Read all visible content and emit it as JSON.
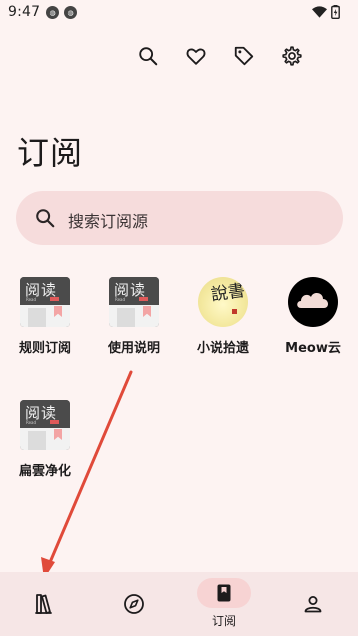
{
  "status_bar": {
    "time": "9:47",
    "notification_icons": [
      "app-notification-icon",
      "app-notification-icon"
    ],
    "right_icons": [
      "wifi-icon",
      "battery-icon"
    ]
  },
  "toolbar": {
    "icons": [
      "search-icon",
      "heart-icon",
      "tag-icon",
      "gear-icon"
    ]
  },
  "page": {
    "title": "订阅"
  },
  "search": {
    "placeholder": "搜索订阅源"
  },
  "sources": [
    {
      "name": "规则订阅",
      "icon": "reader-app-icon",
      "thumb_text": "阅读",
      "thumb_sub": "Read",
      "thumb_badge": "3.0"
    },
    {
      "name": "使用说明",
      "icon": "reader-app-icon",
      "thumb_text": "阅读",
      "thumb_sub": "Read",
      "thumb_badge": "3.0"
    },
    {
      "name": "小说拾遗",
      "icon": "calligraphy-icon",
      "thumb_text": "說書"
    },
    {
      "name": "Meow云",
      "icon": "cloud-icon"
    },
    {
      "name": "扁雲净化",
      "icon": "reader-app-icon",
      "thumb_text": "阅读",
      "thumb_sub": "Read",
      "thumb_badge": "3.0"
    }
  ],
  "bottom_nav": {
    "items": [
      {
        "name": "bookshelf",
        "icon": "book-icon",
        "label": ""
      },
      {
        "name": "discover",
        "icon": "compass-icon",
        "label": ""
      },
      {
        "name": "subscription",
        "icon": "bookmark-icon",
        "label": "订阅",
        "active": true
      },
      {
        "name": "my",
        "icon": "person-icon",
        "label": ""
      }
    ]
  },
  "colors": {
    "background": "#fdf3f2",
    "search_bg": "#f6dcdc",
    "nav_bg": "#f6e6e6",
    "active_pill": "#f7d3d3",
    "annotation_arrow": "#e04a3a"
  }
}
